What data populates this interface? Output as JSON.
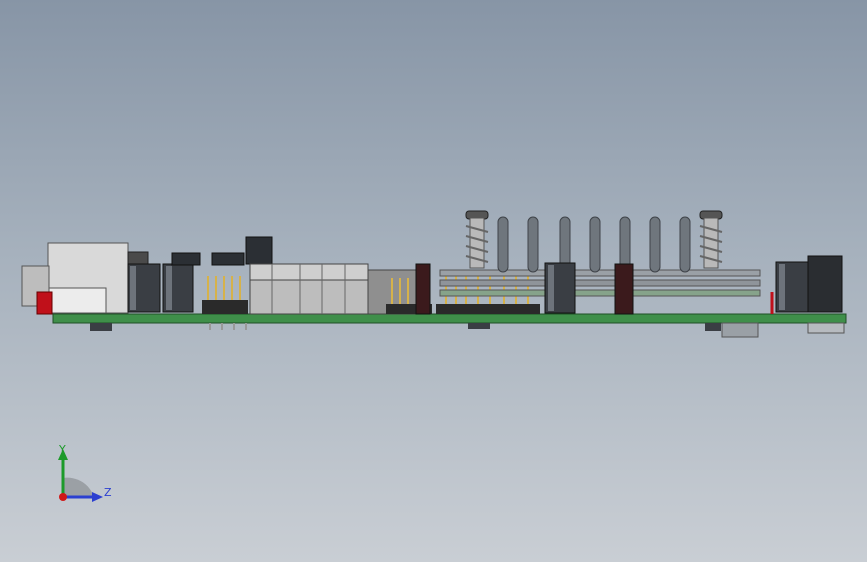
{
  "viewport": {
    "background_top": "#8795a6",
    "background_bottom": "#c9ced4"
  },
  "model": {
    "board_color": "#3f8f4a",
    "capacitor_color": "#3a3e44",
    "connector_color": "#d7d7d7",
    "red_component_color": "#c0101a"
  },
  "triad": {
    "y_label": "Y",
    "z_label": "Z",
    "y_color": "#1c9a2a",
    "z_color": "#2b3fd0",
    "x_color": "#d01818"
  }
}
